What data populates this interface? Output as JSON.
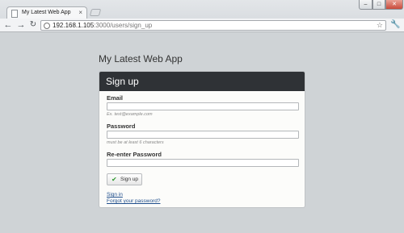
{
  "browser": {
    "tab_title": "My Latest Web App",
    "tab_close": "×",
    "url_host": "192.168.1.105",
    "url_path": ":3000/users/sign_up",
    "window_controls": {
      "minimize": "–",
      "maximize": "□",
      "close": "✕"
    },
    "nav": {
      "back": "←",
      "forward": "→",
      "reload": "↻"
    },
    "bookmark_glyph": "☆",
    "menu_glyph": "🔧"
  },
  "page": {
    "app_title": "My Latest Web App",
    "form": {
      "title": "Sign up",
      "email": {
        "label": "Email",
        "value": "",
        "hint": "Ex. test@example.com"
      },
      "password": {
        "label": "Password",
        "value": "",
        "hint": "must be at least 6 characters"
      },
      "password_confirmation": {
        "label": "Re-enter Password",
        "value": ""
      },
      "submit": {
        "label": "Sign up",
        "icon": "check-icon"
      },
      "links": {
        "sign_in": "Sign in",
        "forgot": "Forgot your password?"
      }
    }
  },
  "colors": {
    "page_background": "#cfd3d6",
    "card_header": "#2f3236",
    "link": "#1f4e8c",
    "check": "#2e9a2e"
  }
}
